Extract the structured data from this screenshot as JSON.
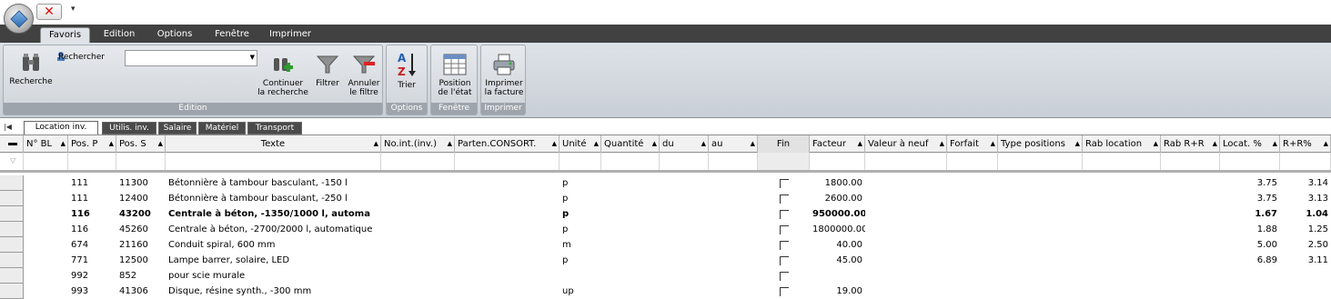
{
  "quick_access": {
    "more_label": "▾"
  },
  "ribbon": {
    "tabs": [
      "Favoris",
      "Edition",
      "Options",
      "Fenêtre",
      "Imprimer"
    ],
    "active_tab": "Favoris",
    "groups": {
      "edition": {
        "title": "Edition",
        "search_label": "Recherche",
        "search_field_label": "Rechercher",
        "search_value": "",
        "continue_label_1": "Continuer",
        "continue_label_2": "la recherche",
        "filter_label": "Filtrer",
        "cancel_filter_1": "Annuler",
        "cancel_filter_2": "le filtre"
      },
      "options": {
        "title": "Options",
        "sort_label": "Trier"
      },
      "fenetre": {
        "title": "Fenêtre",
        "pos_label_1": "Position",
        "pos_label_2": "de l'état"
      },
      "imprimer": {
        "title": "Imprimer",
        "print_label_1": "Imprimer",
        "print_label_2": "la facture"
      }
    }
  },
  "sheet_tabs": [
    "Location inv.",
    "Utilis. inv.",
    "Salaire",
    "Matériel",
    "Transport"
  ],
  "active_sheet": "Location inv.",
  "columns": [
    "N° BL",
    "Pos. P",
    "Pos. S",
    "Texte",
    "No.int.(inv.)",
    "Parten.CONSORT.",
    "Unité",
    "Quantité",
    "du",
    "au",
    "Fin",
    "Facteur",
    "Valeur à neuf",
    "Forfait",
    "Type positions",
    "Rab location",
    "Rab R+R",
    "Locat. %",
    "R+R%"
  ],
  "rows": [
    {
      "pos_p": "111",
      "pos_s": "11300",
      "texte": "Bétonnière à tambour basculant, -150 l",
      "unite": "p",
      "valeur": "1800.00",
      "locat": "3.75",
      "rr": "3.14",
      "bold": false
    },
    {
      "pos_p": "111",
      "pos_s": "12400",
      "texte": "Bétonnière à tambour basculant, -250 l",
      "unite": "p",
      "valeur": "2600.00",
      "locat": "3.75",
      "rr": "3.13",
      "bold": false
    },
    {
      "pos_p": "116",
      "pos_s": "43200",
      "texte": "Centrale à béton, -1350/1000 l, automa",
      "unite": "p",
      "valeur": "950000.00",
      "locat": "1.67",
      "rr": "1.04",
      "bold": true
    },
    {
      "pos_p": "116",
      "pos_s": "45260",
      "texte": "Centrale à béton, -2700/2000 l, automatique",
      "unite": "p",
      "valeur": "1800000.00",
      "locat": "1.88",
      "rr": "1.25",
      "bold": false
    },
    {
      "pos_p": "674",
      "pos_s": "21160",
      "texte": "Conduit spiral,   600 mm",
      "unite": "m",
      "valeur": "40.00",
      "locat": "5.00",
      "rr": "2.50",
      "bold": false
    },
    {
      "pos_p": "771",
      "pos_s": "12500",
      "texte": "Lampe barrer, solaire, LED",
      "unite": "p",
      "valeur": "45.00",
      "locat": "6.89",
      "rr": "3.11",
      "bold": false
    },
    {
      "pos_p": "992",
      "pos_s": "852",
      "texte": "pour scie murale",
      "unite": "",
      "valeur": "",
      "locat": "",
      "rr": "",
      "bold": false
    },
    {
      "pos_p": "993",
      "pos_s": "41306",
      "texte": "Disque, résine synth., -300 mm",
      "unite": "up",
      "valeur": "19.00",
      "locat": "",
      "rr": "",
      "bold": false
    }
  ]
}
